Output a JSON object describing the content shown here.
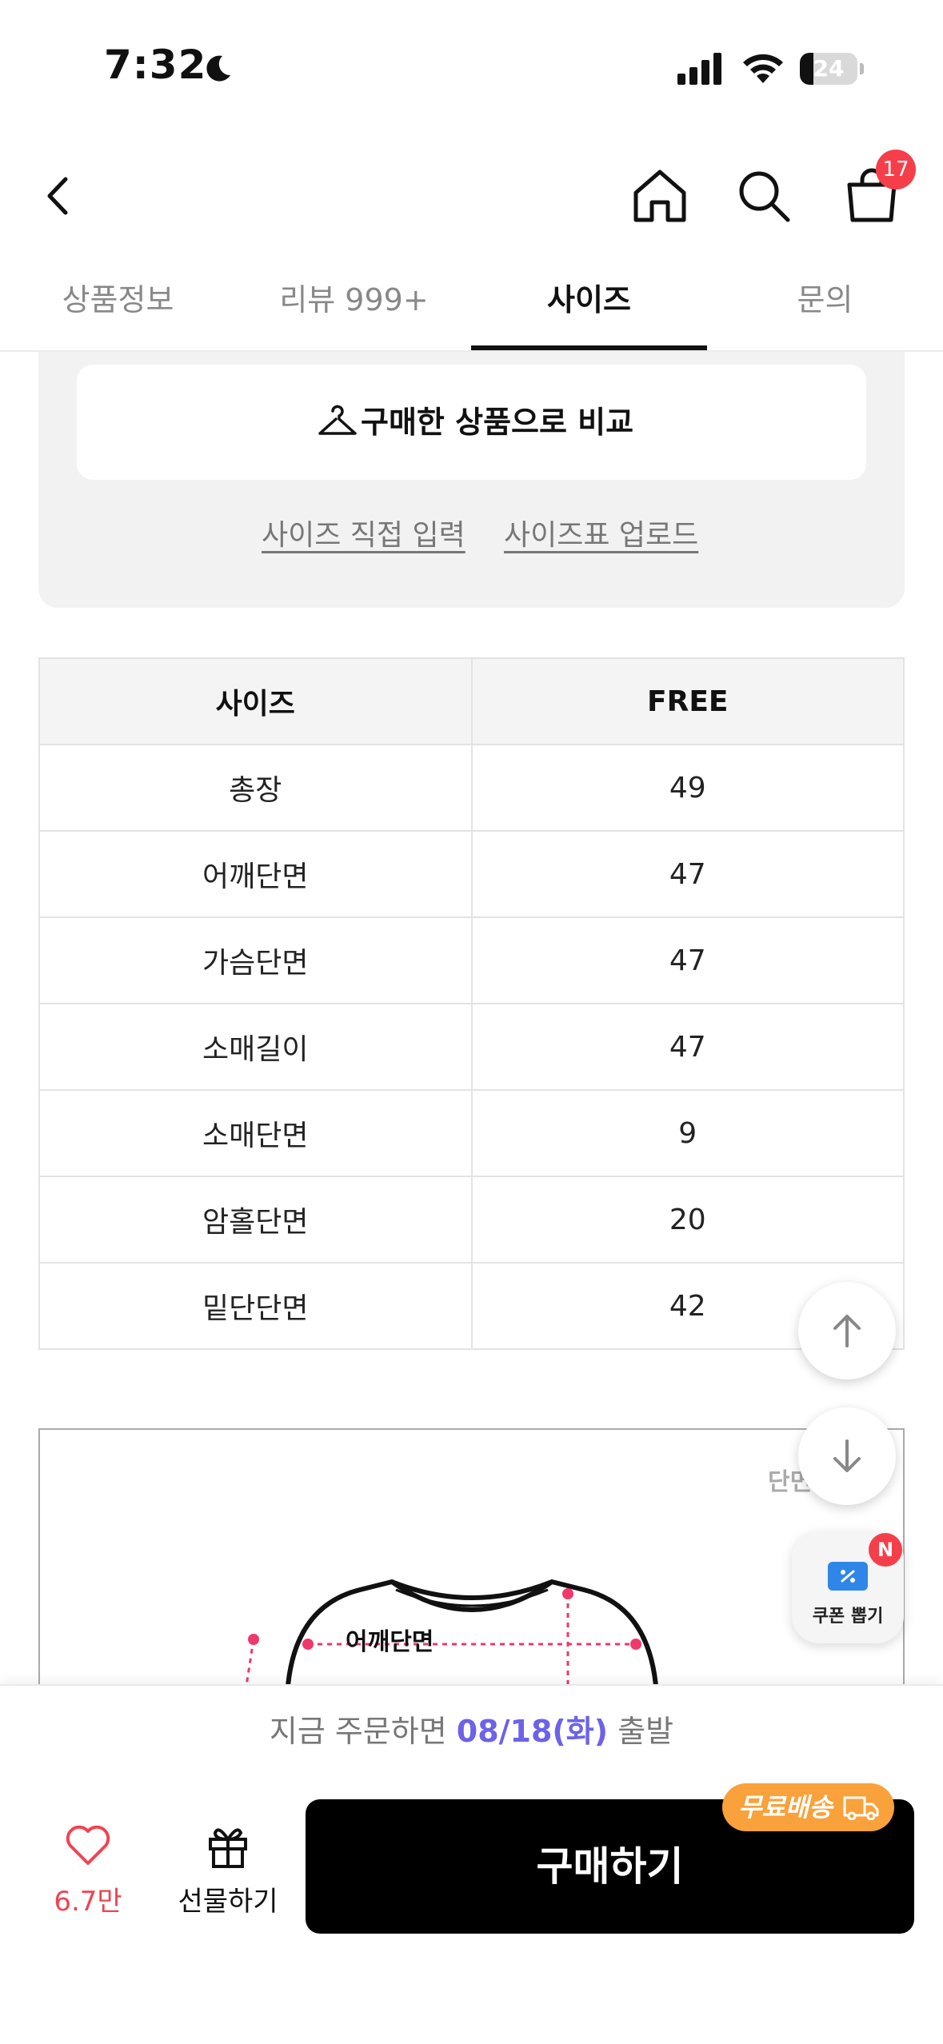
{
  "status_bar": {
    "time": "7:32",
    "battery": "24",
    "battery_level": 0.24
  },
  "top_nav": {
    "cart_count": "17"
  },
  "tabs": [
    {
      "label": "상품정보",
      "active": false
    },
    {
      "label": "리뷰 999+",
      "active": false
    },
    {
      "label": "사이즈",
      "active": true
    },
    {
      "label": "문의",
      "active": false
    }
  ],
  "size_compare": {
    "compare_button_label": "구매한 상품으로 비교",
    "direct_input_link": "사이즈 직접 입력",
    "upload_link": "사이즈표 업로드"
  },
  "size_table": {
    "headers": [
      "사이즈",
      "FREE"
    ],
    "rows": [
      [
        "총장",
        "49"
      ],
      [
        "어깨단면",
        "47"
      ],
      [
        "가슴단면",
        "47"
      ],
      [
        "소매길이",
        "47"
      ],
      [
        "소매단면",
        "9"
      ],
      [
        "암홀단면",
        "20"
      ],
      [
        "밑단단면",
        "42"
      ]
    ]
  },
  "diagram": {
    "label_shoulder": "어깨단면",
    "label_corner": "단면"
  },
  "coupon": {
    "label": "쿠폰 뽑기",
    "badge": "N"
  },
  "bottom_bar": {
    "ship_prefix": "지금 주문하면 ",
    "ship_date": "08/18(화)",
    "ship_suffix": " 출발",
    "like_count": "6.7만",
    "gift_label": "선물하기",
    "buy_label": "구매하기",
    "free_shipping_label": "무료배송"
  },
  "colors": {
    "accent_purple": "#6c63e8",
    "like_red": "#f04452",
    "badge_red": "#f43f4a",
    "free_ship_orange": "#f9a13a",
    "coupon_blue": "#2f86e8"
  }
}
